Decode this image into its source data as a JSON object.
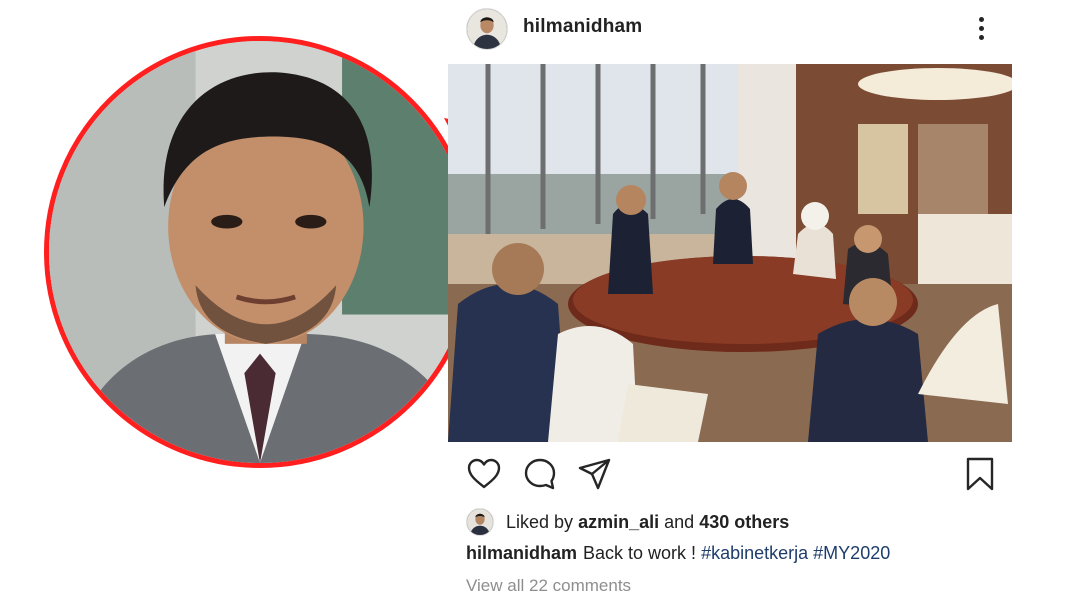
{
  "post": {
    "username": "hilmanidham",
    "liked_by_prefix": "Liked by",
    "liked_by_user": "azmin_ali",
    "liked_by_connector": "and",
    "others_count": "430 others",
    "caption_user": "hilmanidham",
    "caption_text": "Back to work !",
    "hashtags": [
      "#kabinetkerja",
      "#MY2020"
    ],
    "view_comments": "View all 22 comments"
  },
  "icons": {
    "more": "more-vertical-icon",
    "like": "heart-icon",
    "comment": "comment-icon",
    "share": "share-icon",
    "save": "bookmark-icon"
  },
  "colors": {
    "highlight_circle": "#ff1f1f",
    "hashtag": "#1e3d6b",
    "muted_text": "#8e8e8e"
  }
}
